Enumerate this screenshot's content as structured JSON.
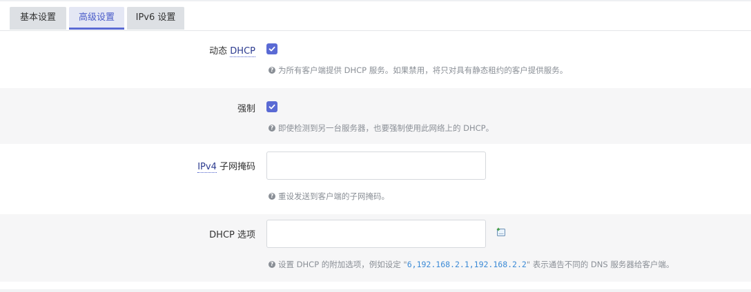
{
  "tabs": [
    {
      "label": "基本设置",
      "active": false
    },
    {
      "label": "高级设置",
      "active": true
    },
    {
      "label": "IPv6 设置",
      "active": false
    }
  ],
  "fields": {
    "dynamic_dhcp": {
      "label_prefix": "动态 ",
      "label_abbr": "DHCP",
      "checked": true,
      "help": "为所有客户端提供 DHCP 服务。如果禁用，将只对具有静态租约的客户提供服务。"
    },
    "force": {
      "label": "强制",
      "checked": true,
      "help": "即使检测到另一台服务器，也要强制使用此网络上的 DHCP。"
    },
    "ipv4_netmask": {
      "label_abbr": "IPv4",
      "label_suffix": " 子网掩码",
      "value": "",
      "help": "重设发送到客户端的子网掩码。"
    },
    "dhcp_options": {
      "label": "DHCP 选项",
      "value": "",
      "help_before": "设置 DHCP 的附加选项，例如设定 \"",
      "help_code": "6,192.168.2.1,192.168.2.2",
      "help_after": "\" 表示通告不同的 DNS 服务器给客户端。"
    }
  },
  "colors": {
    "accent": "#5a6ad4",
    "help_text": "#8a8f96",
    "alt_row": "#f6f6f7"
  },
  "icons": {
    "help": "question-circle-icon",
    "add": "add-option-icon",
    "check": "check-icon"
  }
}
